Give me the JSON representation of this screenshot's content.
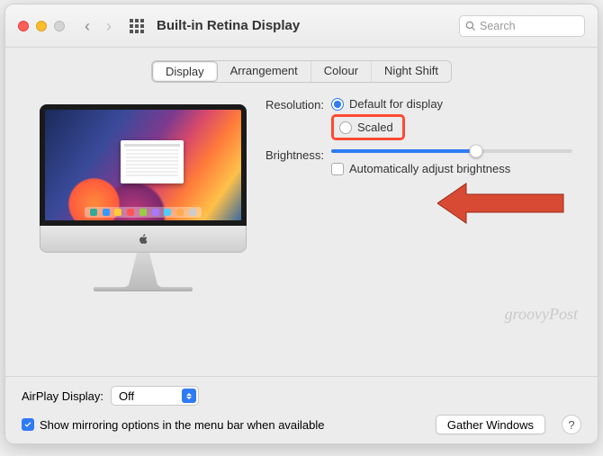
{
  "window": {
    "title": "Built-in Retina Display"
  },
  "search": {
    "placeholder": "Search"
  },
  "tabs": {
    "display": "Display",
    "arrangement": "Arrangement",
    "colour": "Colour",
    "night_shift": "Night Shift"
  },
  "settings": {
    "resolution_label": "Resolution:",
    "resolution_default": "Default for display",
    "resolution_scaled": "Scaled",
    "brightness_label": "Brightness:",
    "auto_brightness": "Automatically adjust brightness"
  },
  "airplay": {
    "label": "AirPlay Display:",
    "value": "Off"
  },
  "footer": {
    "mirror_checkbox": "Show mirroring options in the menu bar when available",
    "gather_button": "Gather Windows",
    "help": "?"
  },
  "watermark": "groovyPost"
}
